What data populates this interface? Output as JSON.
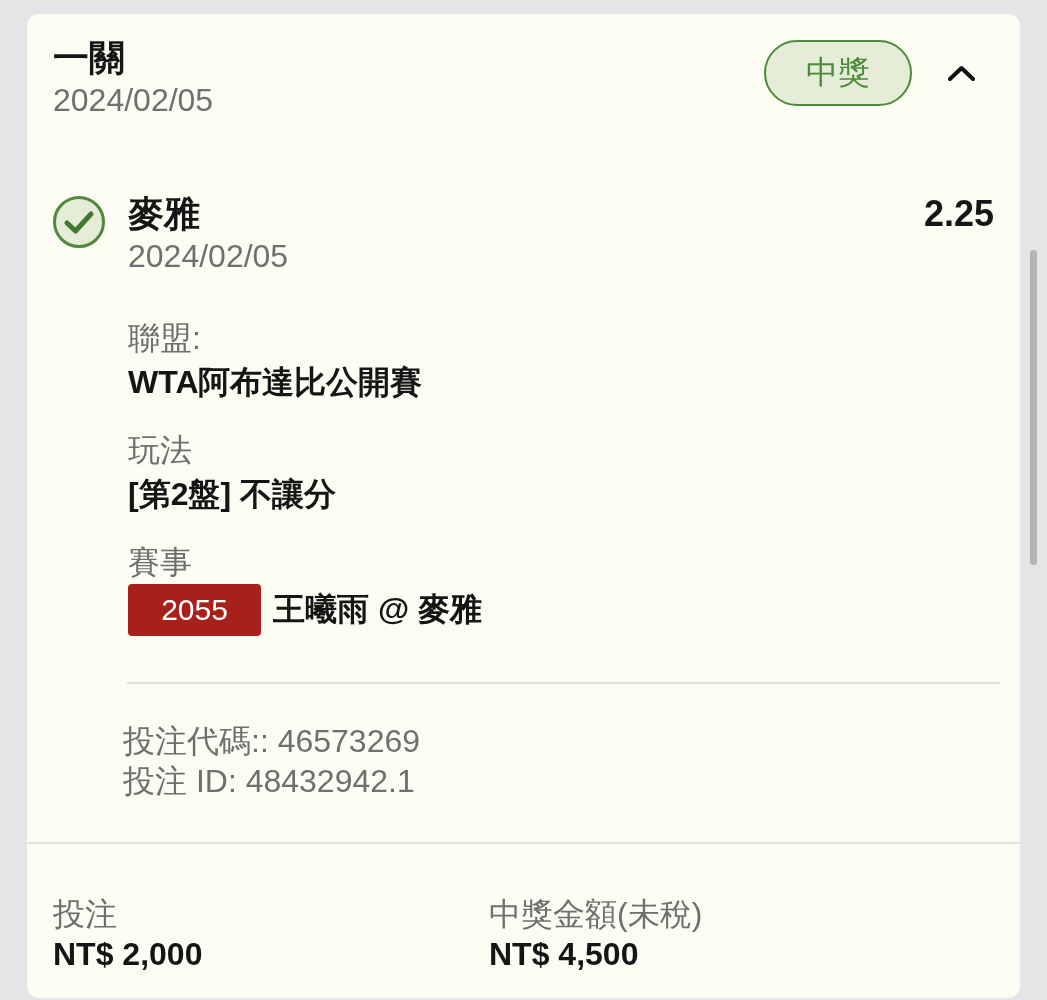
{
  "bet": {
    "title": "一關",
    "date": "2024/02/05",
    "status": {
      "label": "中獎",
      "kind": "won"
    },
    "expanded": true
  },
  "selection": {
    "won": true,
    "name": "麥雅",
    "odds": "2.25",
    "date": "2024/02/05"
  },
  "details": [
    {
      "label": "聯盟:",
      "value": "WTA阿布達比公開賽"
    },
    {
      "label": "玩法",
      "value": "[第2盤] 不讓分"
    },
    {
      "label": "賽事",
      "code": "2055",
      "value": "王曦雨 @ 麥雅"
    }
  ],
  "references": [
    "投注代碼:: 46573269",
    "投注 ID: 48432942.1"
  ],
  "summary": [
    {
      "label": "投注",
      "amount": "NT$ 2,000"
    },
    {
      "label": "中獎金額(未稅)",
      "amount": "NT$ 4,500"
    }
  ]
}
